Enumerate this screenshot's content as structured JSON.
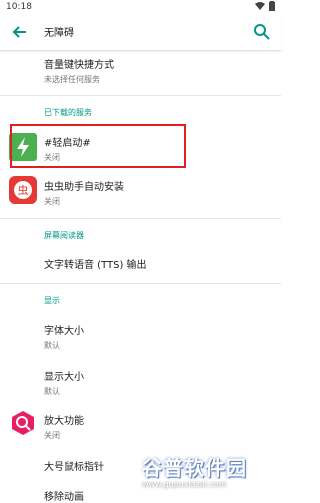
{
  "status_bar": {
    "time": "10:18"
  },
  "app_bar": {
    "title": "无障碍"
  },
  "items": [
    {
      "title": "音量键快捷方式",
      "subtitle": "未选择任何服务"
    }
  ],
  "sections": {
    "downloaded": "已下载的服务",
    "screen_reader": "屏幕阅读器",
    "display": "显示"
  },
  "downloaded_services": [
    {
      "title": "#轻启动#",
      "subtitle": "关闭"
    },
    {
      "title": "虫虫助手自动安装",
      "subtitle": "关闭"
    }
  ],
  "screen_reader_items": [
    {
      "title": "文字转语音 (TTS) 输出"
    }
  ],
  "display_items": [
    {
      "title": "字体大小",
      "subtitle": "默认"
    },
    {
      "title": "显示大小",
      "subtitle": "默认"
    },
    {
      "title": "放大功能",
      "subtitle": "关闭"
    },
    {
      "title": "大号鼠标指针"
    },
    {
      "title": "移除动画"
    }
  ],
  "watermark": {
    "main": "谷普软件园",
    "url": "www.gupuxiazai.com"
  },
  "colors": {
    "accent": "#009688",
    "highlight": "#e02020",
    "icon_green": "#4caf50",
    "icon_red": "#e53935",
    "magnify_pink": "#e91e63"
  }
}
